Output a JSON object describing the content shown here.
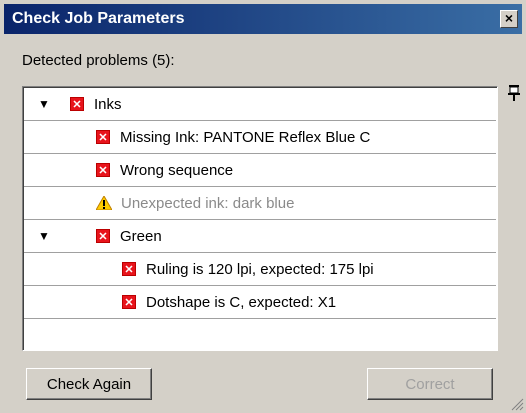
{
  "window": {
    "title": "Check Job Parameters",
    "close_label": "×"
  },
  "section_label": "Detected problems (5):",
  "colors": {
    "title_bar": "#0a246a",
    "error_icon": "#e8141c",
    "warning_icon": "#ffcc00"
  },
  "rows": [
    {
      "text": "Inks",
      "icon": "error-icon",
      "expand": "▼"
    },
    {
      "text": "Missing Ink: PANTONE Reflex Blue C",
      "icon": "error-icon"
    },
    {
      "text": "Wrong sequence",
      "icon": "error-icon"
    },
    {
      "text": "Unexpected ink: dark blue",
      "icon": "warning-icon"
    },
    {
      "text": "Green",
      "icon": "error-icon",
      "expand": "▼"
    },
    {
      "text": "Ruling is 120 lpi, expected: 175 lpi",
      "icon": "error-icon"
    },
    {
      "text": "Dotshape is C, expected: X1",
      "icon": "error-icon"
    }
  ],
  "buttons": {
    "check_again": "Check Again",
    "correct": "Correct"
  }
}
